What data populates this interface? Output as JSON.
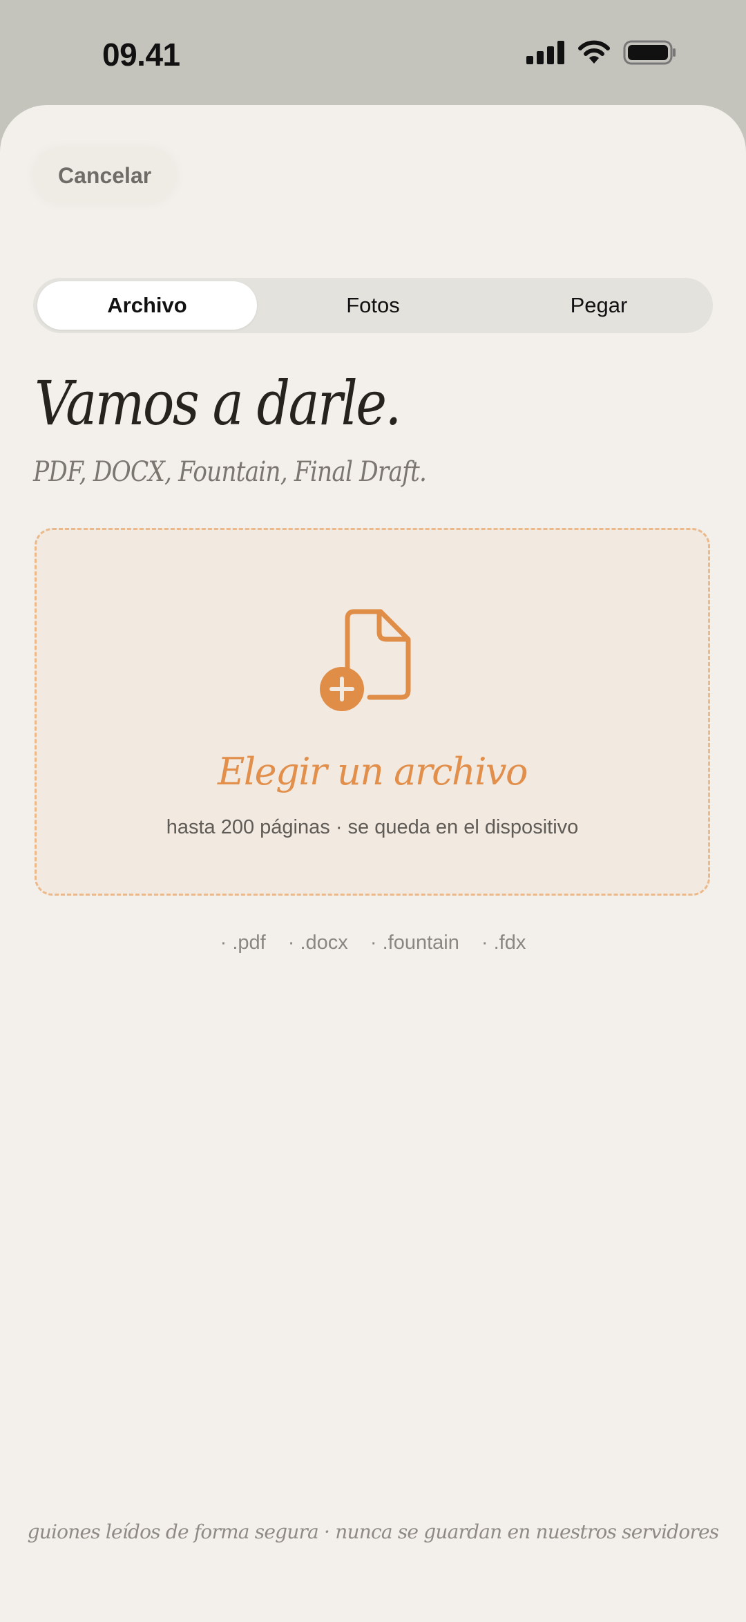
{
  "status_bar": {
    "time": "09.41",
    "icons": [
      "cellular-signal-icon",
      "wifi-icon",
      "battery-icon"
    ]
  },
  "header": {
    "cancel_label": "Cancelar"
  },
  "tabs": {
    "items": [
      {
        "label": "Archivo",
        "selected": true
      },
      {
        "label": "Fotos",
        "selected": false
      },
      {
        "label": "Pegar",
        "selected": false
      }
    ]
  },
  "main": {
    "title": "Vamos a darle.",
    "subtitle": "PDF, DOCX, Fountain, Final Draft."
  },
  "dropzone": {
    "icon": "file-add-icon",
    "action_label": "Elegir un archivo",
    "hint": "hasta 200 páginas · se queda en el dispositivo"
  },
  "formats": [
    "· .pdf",
    "· .docx",
    "· .fountain",
    "· .fdx"
  ],
  "footer": {
    "note": "guiones leídos de forma segura · nunca se guardan en nuestros servidores"
  },
  "colors": {
    "accent": "#e18f4b",
    "dropzone_border": "#ebb98a",
    "sheet_background": "#f3f0eb",
    "top_background": "#c4c3bc"
  }
}
